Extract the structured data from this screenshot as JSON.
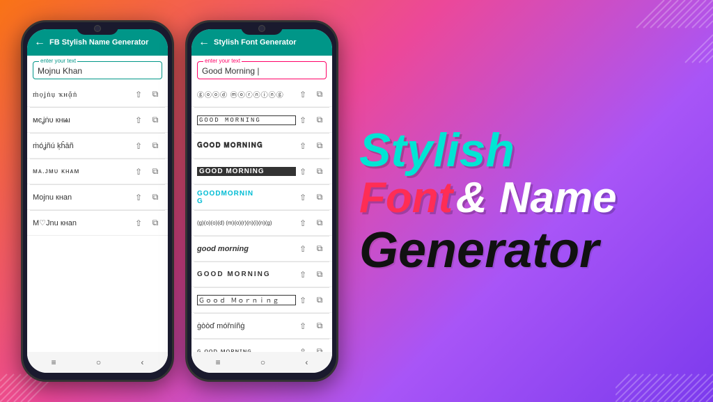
{
  "background": {
    "gradient": "orange to purple"
  },
  "phone1": {
    "header": {
      "title": "FB Stylish Name Generator",
      "back": "←"
    },
    "input": {
      "label": "enter your text",
      "value": "Mojnu Khan"
    },
    "fonts": [
      {
        "text": "ṁọʝṅụ ҡнᾄṅ",
        "style": "dotted"
      },
      {
        "text": "мєʝṅυ кнѩι",
        "style": "cyrillic"
      },
      {
        "text": "ṁóʝñú ķĥāñ",
        "style": "accent"
      },
      {
        "text": "ᴍᴀ.ᴊᴍᴜ ᴋʜᴀᴍ",
        "style": "smallcaps"
      },
      {
        "text": "Mojnu кнan",
        "style": "mixed"
      },
      {
        "text": "M♡Jnu кнan",
        "style": "heart"
      }
    ],
    "nav": [
      "≡",
      "○",
      "‹"
    ]
  },
  "phone2": {
    "header": {
      "title": "Stylish Font Generator",
      "back": "←"
    },
    "input": {
      "label": "enter your text",
      "value": "Good Morning |"
    },
    "fonts": [
      {
        "text": "ⓖⓞⓞⓓ ⓜⓞⓡⓝⓘⓝⓖ",
        "style": "circled"
      },
      {
        "text": "GOOD MORNING",
        "style": "outlined"
      },
      {
        "text": "𝐆𝐎𝐎𝐃 𝐌𝐎𝐑𝐍𝐈𝐍𝐆",
        "style": "bold-serif"
      },
      {
        "text": "GOOD MORNING",
        "style": "black-bg"
      },
      {
        "text": "GOODMORNIN G",
        "style": "teal"
      },
      {
        "text": "(g)(o)(o)(d) (m)(o)(r)(n)(i)(n)(g)",
        "style": "bubble"
      },
      {
        "text": "good morning",
        "style": "italic-bold"
      },
      {
        "text": "GOOD MORNING",
        "style": "uppercase-light"
      },
      {
        "text": "Ｇｏｏｄ Ｍｏｒｎｉｎｇ",
        "style": "pixel"
      },
      {
        "text": "ġòòď móřníñġ",
        "style": "accent2"
      },
      {
        "text": "ɢ ᴏᴏᴅ ᴍᴏʀɴɪɴɢ",
        "style": "smallcaps2"
      }
    ],
    "nav": [
      "≡",
      "○",
      "‹"
    ]
  },
  "headline": {
    "line1": "Stylish",
    "line2_part1": "Font",
    "line2_part2": "& Name",
    "line3": "Generator"
  }
}
